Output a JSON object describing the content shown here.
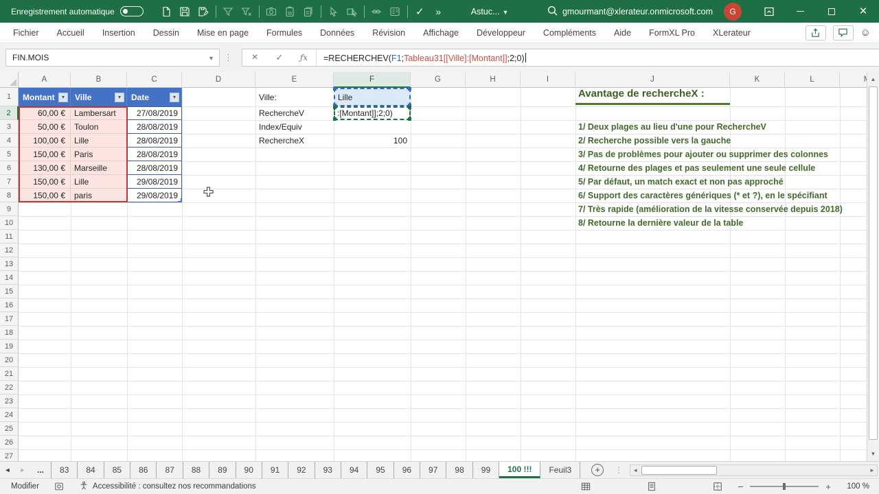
{
  "title_bar": {
    "autosave_label": "Enregistrement automatique",
    "doc_title": "Astuc...",
    "account_email": "gmourmant@xlerateur.onmicrosoft.com",
    "avatar_initial": "G"
  },
  "ribbon": {
    "tabs": [
      "Fichier",
      "Accueil",
      "Insertion",
      "Dessin",
      "Mise en page",
      "Formules",
      "Données",
      "Révision",
      "Affichage",
      "Développeur",
      "Compléments",
      "Aide",
      "FormXL Pro",
      "XLerateur"
    ]
  },
  "formula_bar": {
    "name_box": "FIN.MOIS",
    "prefix": "=RECHERCHEV(",
    "ref1": "F1",
    "sep": ";",
    "ref2": "Tableau31[[Ville]:[Montant]]",
    "suffix": ";2;0)"
  },
  "grid": {
    "columns": [
      "A",
      "B",
      "C",
      "D",
      "E",
      "F",
      "G",
      "H",
      "I",
      "J",
      "K",
      "L",
      "M"
    ],
    "row_numbers": [
      "1",
      "2",
      "3",
      "4",
      "5",
      "6",
      "7",
      "8",
      "9",
      "10",
      "11",
      "12",
      "13",
      "14",
      "15",
      "16",
      "17",
      "18",
      "19",
      "20",
      "21",
      "22",
      "23",
      "24",
      "25",
      "26",
      "27"
    ],
    "table": {
      "headers": [
        "Montant",
        "Ville",
        "Date"
      ],
      "rows": [
        {
          "montant": "60,00 €",
          "ville": "Lambersart",
          "date": "27/08/2019"
        },
        {
          "montant": "50,00 €",
          "ville": "Toulon",
          "date": "28/08/2019"
        },
        {
          "montant": "100,00 €",
          "ville": "Lille",
          "date": "28/08/2019"
        },
        {
          "montant": "150,00 €",
          "ville": "Paris",
          "date": "28/08/2019"
        },
        {
          "montant": "130,00 €",
          "ville": "Marseille",
          "date": "28/08/2019"
        },
        {
          "montant": "150,00 €",
          "ville": "Lille",
          "date": "29/08/2019"
        },
        {
          "montant": "150,00 €",
          "ville": "paris",
          "date": "29/08/2019"
        }
      ]
    },
    "lookup": {
      "labels": [
        "Ville:",
        "RechercheV",
        "Index/Equiv",
        "RechercheX"
      ],
      "f1_value": "Lille",
      "f2_value": ":[Montant]];2;0)",
      "f4_value": "100"
    },
    "advantages": {
      "title": "Avantage de rechercheX :",
      "items": [
        "1/ Deux plages au lieu d'une pour RechercheV",
        "2/ Recherche possible vers la gauche",
        "3/ Pas de problèmes pour ajouter ou supprimer des colonnes",
        "4/ Retourne des plages et pas seulement une seule cellule",
        "5/ Par défaut, un match exact et non pas approché",
        "6/ Support des caractères génériques (* et ?), en le spécifiant",
        "7/ Très rapide (amélioration de la vitesse conservée depuis 2018)",
        "8/ Retourne la dernière valeur de la table"
      ]
    }
  },
  "sheet_tabs": {
    "ellipsis": "...",
    "numbers": [
      "83",
      "84",
      "85",
      "86",
      "87",
      "88",
      "89",
      "90",
      "91",
      "92",
      "93",
      "94",
      "95",
      "96",
      "97",
      "98",
      "99"
    ],
    "active": "100 !!!",
    "trailing": "Feuil3"
  },
  "status_bar": {
    "mode_label": "Modifier",
    "accessibility_label": "Accessibilité : consultez nos recommandations",
    "zoom_label": "100 %"
  },
  "colors": {
    "titlebar_green": "#1E6F43",
    "accent_green": "#217346",
    "table_header_blue": "#4472C4",
    "range_red_border": "#B63A32",
    "range_pink_fill": "#FCE4E2",
    "date_border_blue": "#3B5EA8",
    "ref_blue": "#2667C9",
    "ref_red": "#CE4A42",
    "advantages_green": "#44682D",
    "avatar_red": "#C74634"
  }
}
